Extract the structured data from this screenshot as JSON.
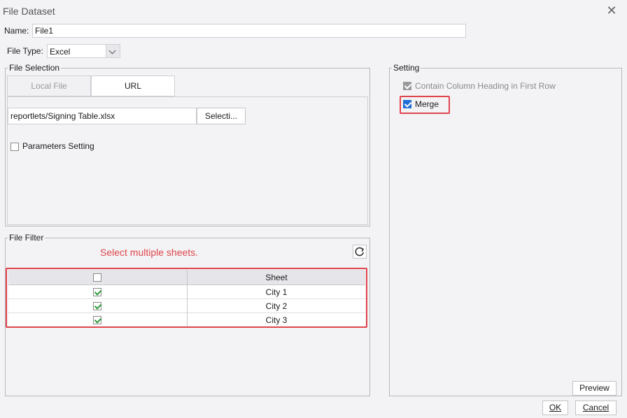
{
  "dialog": {
    "title": "File Dataset",
    "close_icon": "close-icon"
  },
  "name_field": {
    "label": "Name:",
    "value": "File1"
  },
  "file_type": {
    "label": "File Type:",
    "selected": "Excel"
  },
  "file_selection": {
    "title": "File Selection",
    "tabs": [
      {
        "label": "Local File",
        "active": false
      },
      {
        "label": "URL",
        "active": true
      }
    ],
    "path_value": "reportlets/Signing Table.xlsx",
    "select_button": "Selecti...",
    "parameters_label": "Parameters Setting"
  },
  "file_filter": {
    "title": "File Filter",
    "annotation": "Select multiple sheets.",
    "refresh_icon": "refresh-icon",
    "columns": [
      "",
      "Sheet"
    ],
    "rows": [
      {
        "checked": true,
        "sheet": "City 1"
      },
      {
        "checked": true,
        "sheet": "City 2"
      },
      {
        "checked": true,
        "sheet": "City 3"
      }
    ]
  },
  "setting": {
    "title": "Setting",
    "contain_heading_label": "Contain Column Heading in First Row",
    "merge_label": "Merge"
  },
  "buttons": {
    "preview": "Preview",
    "ok": "OK",
    "cancel": "Cancel"
  },
  "colors": {
    "annotation_red": "#e0454b",
    "checkbox_blue": "#1f6fd6",
    "check_green": "#2d9a3a"
  }
}
